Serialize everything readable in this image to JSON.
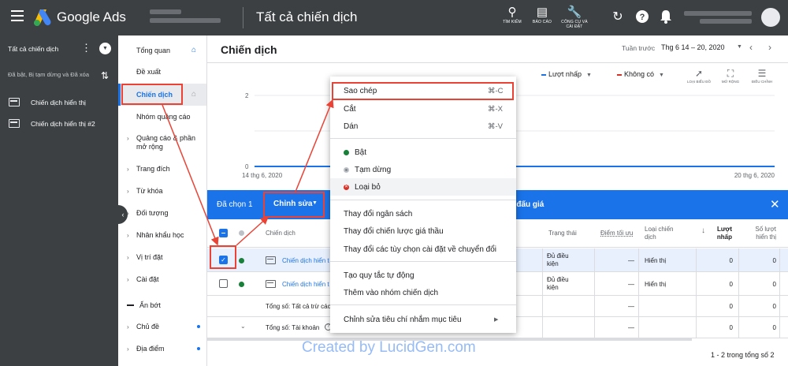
{
  "topbar": {
    "brand": "Google Ads",
    "title": "Tất cả chiến dịch",
    "tools": [
      {
        "icon": "search-icon",
        "label": "TÌM KIẾM"
      },
      {
        "icon": "reports-icon",
        "label": "BÁO CÁO"
      },
      {
        "icon": "tools-icon",
        "label": "CÔNG CỤ VÀ CÀI ĐẶT"
      }
    ]
  },
  "leftpanel": {
    "all_campaigns": "Tất cả chiến dịch",
    "filter": "Đã bật, Bị tạm dừng và Đã xóa",
    "campaigns": [
      "Chiến dịch hiển thị",
      "Chiến dịch hiển thị #2"
    ]
  },
  "nav": {
    "items": [
      {
        "label": "Tổng quan",
        "arrow": false
      },
      {
        "label": "Đề xuất",
        "arrow": false
      },
      {
        "label": "Chiến dịch",
        "arrow": false
      },
      {
        "label": "Nhóm quảng cáo",
        "arrow": false
      },
      {
        "label": "Quảng cáo & phần mở rộng",
        "arrow": true
      },
      {
        "label": "Trang đích",
        "arrow": true
      },
      {
        "label": "Từ khóa",
        "arrow": true
      },
      {
        "label": "Đối tượng",
        "arrow": true
      },
      {
        "label": "Nhân khẩu học",
        "arrow": true
      },
      {
        "label": "Vị trí đặt",
        "arrow": true
      },
      {
        "label": "Cài đặt",
        "arrow": true
      },
      {
        "label": "Ẩn bớt",
        "arrow": false
      },
      {
        "label": "Chủ đề",
        "arrow": true
      },
      {
        "label": "Địa điểm",
        "arrow": true
      }
    ]
  },
  "main": {
    "title": "Chiến dịch",
    "date_label": "Tuần trước",
    "date_range": "Thg 6 14 – 20, 2020",
    "legend": [
      {
        "label": "Lượt nhấp",
        "color": "#1a73e8"
      },
      {
        "label": "Không có",
        "color": "#d93025"
      }
    ],
    "chart_tools": [
      {
        "icon": "chart-type-icon",
        "label": "LOẠI BIỂU ĐỒ"
      },
      {
        "icon": "expand-icon",
        "label": "MỞ RỘNG"
      },
      {
        "icon": "adjust-icon",
        "label": "ĐIỀU CHỈNH"
      }
    ],
    "selection": {
      "count": "Đã chọn 1",
      "edit": "Chỉnh sửa",
      "bid": "ề đấu giá"
    },
    "table": {
      "headers": {
        "campaign": "Chiến dịch",
        "status": "Trạng thái",
        "opt_score": "Điểm tối ưu",
        "type": "Loại chiến dịch",
        "clicks": "Lượt nhấp",
        "impressions": "Số lượt hiển thị"
      },
      "rows": [
        {
          "name": "Chiến dịch hiển t",
          "status": "Đủ điều kiện",
          "opt": "—",
          "type": "Hiển thị",
          "clicks": "0",
          "impr": "0",
          "selected": true
        },
        {
          "name": "Chiến dịch hiển t",
          "status": "Đủ điều kiện",
          "opt": "—",
          "type": "Hiển thị",
          "clicks": "0",
          "impr": "0",
          "selected": false
        }
      ],
      "totals": [
        {
          "label": "Tổng số: Tất cả trừ các",
          "opt": "—",
          "clicks": "0",
          "impr": "0"
        },
        {
          "label": "Tổng số: Tài khoản",
          "opt": "—",
          "clicks": "0",
          "impr": "0"
        }
      ]
    },
    "pagecount": "1 - 2 trong tổng số 2"
  },
  "menu": {
    "items": [
      {
        "label": "Sao chép",
        "shortcut": "⌘-C"
      },
      {
        "label": "Cắt",
        "shortcut": "⌘-X"
      },
      {
        "label": "Dán",
        "shortcut": "⌘-V"
      },
      {
        "label": "Bật",
        "dot": "#188038"
      },
      {
        "label": "Tạm dừng",
        "dot": "#80868b"
      },
      {
        "label": "Loại bỏ",
        "dot": "#d93025"
      },
      {
        "label": "Thay đổi ngân sách"
      },
      {
        "label": "Thay đổi chiến lược giá thầu"
      },
      {
        "label": "Thay đổi các tùy chọn cài đặt về chuyển đổi"
      },
      {
        "label": "Tạo quy tắc tự động"
      },
      {
        "label": "Thêm vào nhóm chiến dịch"
      },
      {
        "label": "Chỉnh sửa tiêu chí nhắm mục tiêu"
      }
    ]
  },
  "chart_data": {
    "type": "line",
    "x_start_label": "14 thg 6, 2020",
    "x_end_label": "20 thg 6, 2020",
    "yticks": [
      0,
      1,
      2
    ],
    "ylim": [
      0,
      2
    ],
    "series": [
      {
        "name": "Lượt nhấp",
        "values": [
          0,
          0,
          0,
          0,
          0,
          0,
          0
        ]
      }
    ]
  },
  "watermark": "Created by LucidGen.com"
}
